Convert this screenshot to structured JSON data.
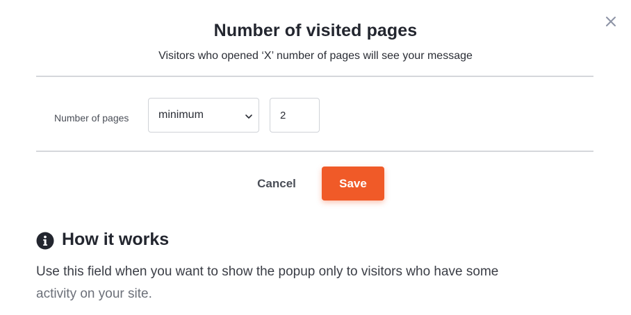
{
  "dialog": {
    "title": "Number of visited pages",
    "subtitle": "Visitors who opened ‘X’ number of pages will see your message",
    "close_icon": "close-icon"
  },
  "form": {
    "label": "Number of pages",
    "operator": {
      "selected": "minimum",
      "icon": "chevron-down-icon"
    },
    "pages_value": "2"
  },
  "actions": {
    "cancel_label": "Cancel",
    "save_label": "Save",
    "save_color": "#f05a28"
  },
  "help": {
    "icon": "info-icon",
    "heading": "How it works",
    "body_line1": "Use this field when you want to show the popup only to visitors who have some",
    "body_line2": "activity on your site."
  }
}
